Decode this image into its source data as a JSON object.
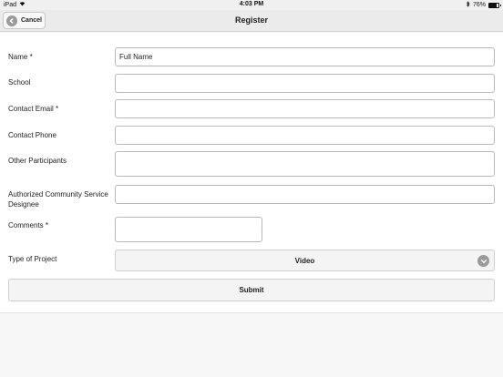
{
  "statusbar": {
    "device": "iPad",
    "wifi_icon": "wifi-icon",
    "time": "4:03 PM",
    "bluetooth_icon": "bluetooth-icon",
    "battery_percent": "76%",
    "battery_level": 0.76
  },
  "navbar": {
    "title": "Register",
    "cancel_label": "Cancel",
    "cancel_icon": "back-arrow-icon"
  },
  "form": {
    "name_label": "Name *",
    "name_value": "Full Name",
    "school_label": "School",
    "school_value": "",
    "email_label": "Contact Email *",
    "email_value": "",
    "phone_label": "Contact Phone",
    "phone_value": "",
    "participants_label": "Other Participants",
    "participants_value": "",
    "designee_label": "Authorized Community Service Designee",
    "designee_value": "",
    "comments_label": "Comments *",
    "comments_value": "",
    "project_type_label": "Type of Project",
    "project_type_value": "Video",
    "project_type_icon": "chevron-down-icon",
    "submit_label": "Submit"
  }
}
